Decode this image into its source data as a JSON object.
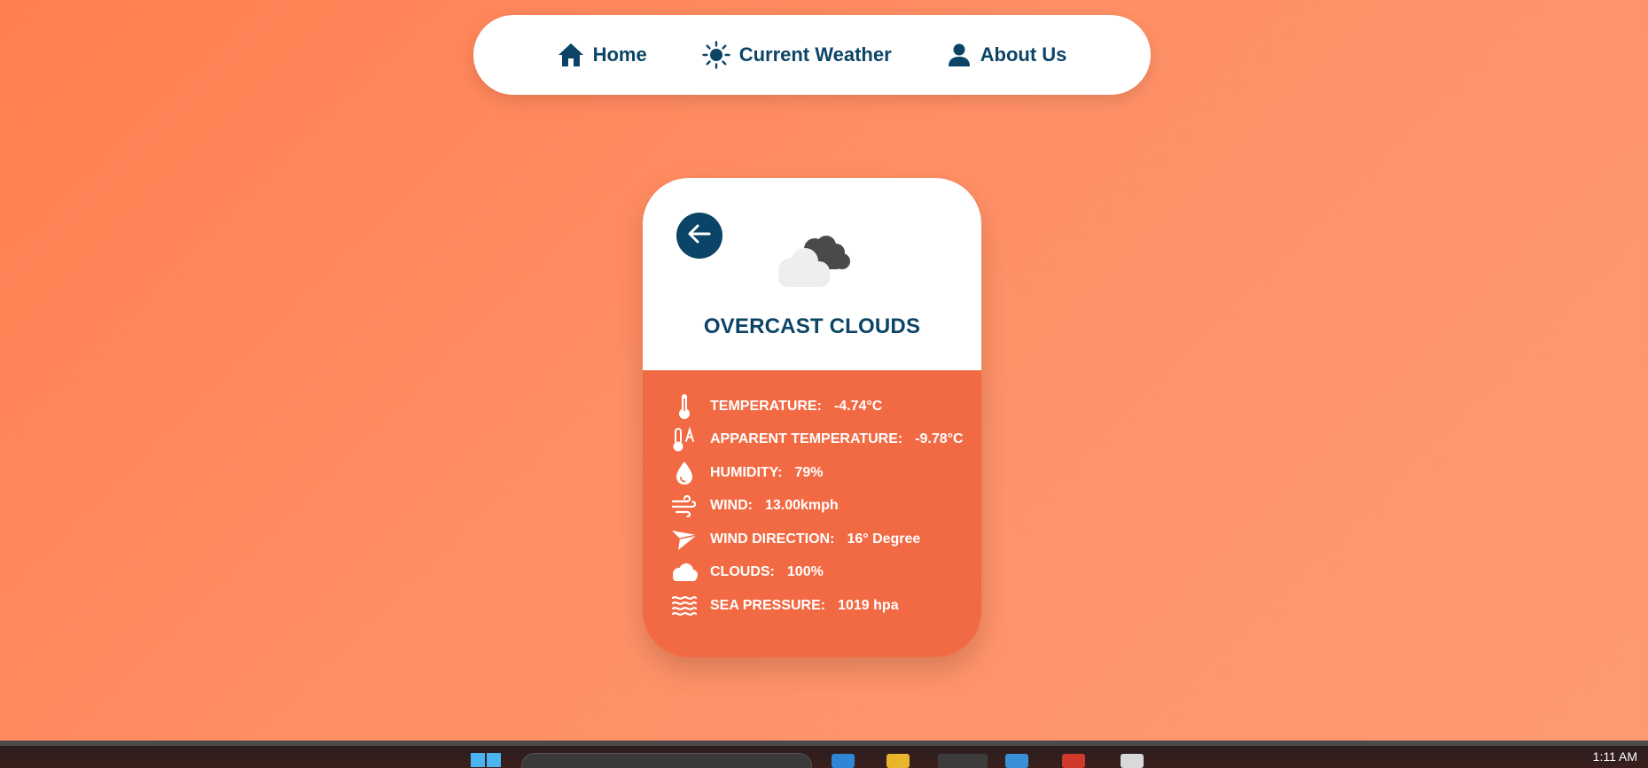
{
  "nav": {
    "items": [
      {
        "label": "Home",
        "icon": "home-icon"
      },
      {
        "label": "Current Weather",
        "icon": "sun-icon"
      },
      {
        "label": "About Us",
        "icon": "user-icon"
      }
    ]
  },
  "card": {
    "condition": "OVERCAST CLOUDS",
    "icon": "overcast-clouds-icon",
    "details": [
      {
        "label": "TEMPERATURE:",
        "value": "-4.74°C",
        "icon": "thermometer-icon"
      },
      {
        "label": "APPARENT TEMPERATURE:",
        "value": "-9.78°C",
        "icon": "apparent-temperature-icon"
      },
      {
        "label": "HUMIDITY:",
        "value": "79%",
        "icon": "water-drop-icon"
      },
      {
        "label": "WIND:",
        "value": "13.00kmph",
        "icon": "wind-icon"
      },
      {
        "label": "WIND DIRECTION:",
        "value": "16° Degree",
        "icon": "paper-plane-icon"
      },
      {
        "label": "CLOUDS:",
        "value": "100%",
        "icon": "cloud-icon"
      },
      {
        "label": "SEA PRESSURE:",
        "value": "1019 hpa",
        "icon": "waves-icon"
      }
    ]
  },
  "taskbar": {
    "time": "1:11 AM"
  },
  "colors": {
    "primary": "#0b4466",
    "card_bottom": "#f26a43",
    "background": "#ff8c60"
  }
}
